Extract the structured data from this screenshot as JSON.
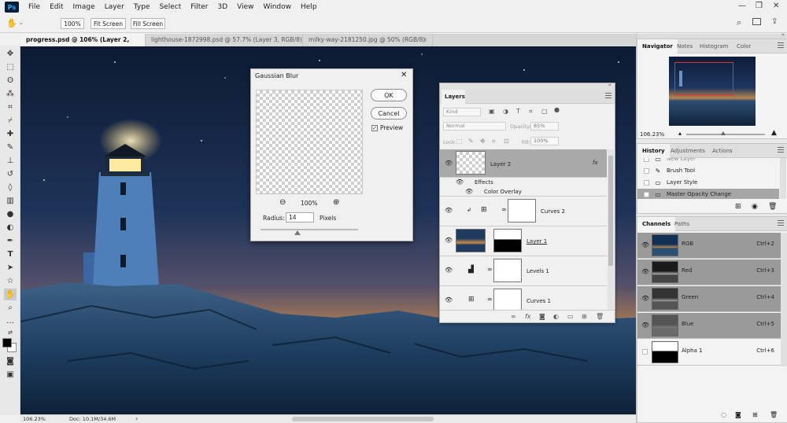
{
  "app": {
    "logo": "Ps"
  },
  "menu": [
    "File",
    "Edit",
    "Image",
    "Layer",
    "Type",
    "Select",
    "Filter",
    "3D",
    "View",
    "Window",
    "Help"
  ],
  "window_controls": {
    "minimize": "—",
    "restore": "❐",
    "close": "✕"
  },
  "options": {
    "zoom": "100%",
    "fit_screen": "Fit Screen",
    "fill_screen": "Fill Screen"
  },
  "tabs": [
    {
      "label": "progress.psd @ 106% (Layer 2, RGB/8) *",
      "close": "×"
    },
    {
      "label": "lighthouse-1872998.psd @ 57.7% (Layer 3, RGB/8) *",
      "close": "×"
    },
    {
      "label": "milky-way-2181250.jpg @ 50% (RGB/8)",
      "close": "×"
    }
  ],
  "status": {
    "zoom": "106.23%",
    "doc": "Doc: 10.1M/34.6M",
    "arrow": "›"
  },
  "dialog": {
    "title": "Gaussian Blur",
    "close": "✕",
    "ok": "OK",
    "cancel": "Cancel",
    "preview": "Preview",
    "zoom": "100%",
    "radius_label": "Radius:",
    "radius_value": "14",
    "unit": "Pixels",
    "slider_value": 0.38
  },
  "layers_panel": {
    "title": "Layers",
    "kind": "Kind",
    "blend_mode": "Normal",
    "opacity_label": "Opacity:",
    "opacity": "85%",
    "lock_label": "Lock:",
    "fill_label": "Fill:",
    "fill": "100%",
    "layers": [
      {
        "name": "Layer 2",
        "fx": "fx"
      },
      {
        "name": "Effects"
      },
      {
        "name": "Color Overlay"
      },
      {
        "name": "Curves 2"
      },
      {
        "name": "Layer 1"
      },
      {
        "name": "Levels 1"
      },
      {
        "name": "Curves 1"
      }
    ]
  },
  "navigator": {
    "tabs": [
      "Navigator",
      "Notes",
      "Histogram",
      "Color"
    ],
    "zoom": "106.23%"
  },
  "history": {
    "tabs": [
      "History",
      "Adjustments",
      "Actions"
    ],
    "items": [
      {
        "label": "New Layer",
        "icon": "▭"
      },
      {
        "label": "Brush Tool",
        "icon": "✎"
      },
      {
        "label": "Layer Style",
        "icon": "▭"
      },
      {
        "label": "Master Opacity Change",
        "icon": "▭"
      }
    ]
  },
  "channels": {
    "tabs": [
      "Channels",
      "Paths"
    ],
    "items": [
      {
        "name": "RGB",
        "shortcut": "Ctrl+2"
      },
      {
        "name": "Red",
        "shortcut": "Ctrl+3"
      },
      {
        "name": "Green",
        "shortcut": "Ctrl+4"
      },
      {
        "name": "Blue",
        "shortcut": "Ctrl+5"
      },
      {
        "name": "Alpha 1",
        "shortcut": "Ctrl+6"
      }
    ]
  },
  "colors": {
    "accent": "#31a8ff",
    "nav_box": "#e03030",
    "selected_row": "#a6a6a6"
  }
}
